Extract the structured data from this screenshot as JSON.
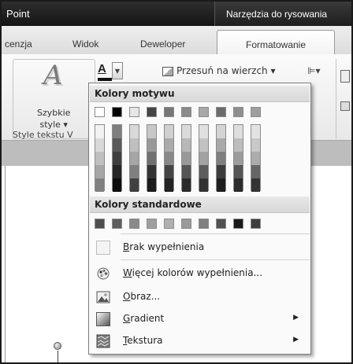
{
  "titlebar": {
    "app_title_fragment": "Point",
    "contextual_title": "Narzędzia do rysowania"
  },
  "tabs": [
    {
      "label": "cenzja",
      "active": false
    },
    {
      "label": "Widok",
      "active": false
    },
    {
      "label": "Deweloper",
      "active": false
    },
    {
      "label": "Formatowanie",
      "active": true
    }
  ],
  "ribbon": {
    "quick_styles_label_line1": "Szybkie",
    "quick_styles_label_line2": "style ▾",
    "group_label": "Style tekstu V",
    "font_color_glyph": "A",
    "bring_forward_label": "Przesuń na wierzch ▾",
    "align_glyph": "⊫▾"
  },
  "popup": {
    "theme_colors_header": "Kolory motywu",
    "standard_colors_header": "Kolory standardowe",
    "theme_top_row": [
      "#ffffff",
      "#000000",
      "#e6e6e6",
      "#444444",
      "#777777",
      "#8a8a8a",
      "#a8a8a8",
      "#6b6b6b",
      "#8f8f8f",
      "#9e9e9e"
    ],
    "theme_columns": [
      [
        "#f2f2f2",
        "#d9d9d9",
        "#bfbfbf",
        "#a6a6a6",
        "#808080"
      ],
      [
        "#7f7f7f",
        "#595959",
        "#3f3f3f",
        "#262626",
        "#0d0d0d"
      ],
      [
        "#d9d9d9",
        "#bfbfbf",
        "#a6a6a6",
        "#808080",
        "#404040"
      ],
      [
        "#c8c8c8",
        "#999999",
        "#707070",
        "#333333",
        "#1a1a1a"
      ],
      [
        "#d0d0d0",
        "#aaaaaa",
        "#888888",
        "#444444",
        "#222222"
      ],
      [
        "#dadada",
        "#b8b8b8",
        "#999999",
        "#555555",
        "#2a2a2a"
      ],
      [
        "#e0e0e0",
        "#c2c2c2",
        "#a3a3a3",
        "#5c5c5c",
        "#333333"
      ],
      [
        "#d4d4d4",
        "#a9a9a9",
        "#7f7f7f",
        "#3c3c3c",
        "#1e1e1e"
      ],
      [
        "#dedede",
        "#bdbdbd",
        "#9c9c9c",
        "#555555",
        "#2b2b2b"
      ],
      [
        "#e3e3e3",
        "#c8c8c8",
        "#acacac",
        "#666666",
        "#333333"
      ]
    ],
    "standard_row": [
      "#4d4d4d",
      "#5e5e5e",
      "#8a8a8a",
      "#a0a0a0",
      "#b0b0b0",
      "#9a9a9a",
      "#808080",
      "#505050",
      "#1a1a1a",
      "#3d3d3d"
    ],
    "no_fill": {
      "ul": "B",
      "rest": "rak wypełnienia"
    },
    "more_colors": {
      "ul": "W",
      "rest": "ięcej kolorów wypełnienia..."
    },
    "picture": {
      "ul": "O",
      "rest": "braz..."
    },
    "gradient": {
      "ul": "G",
      "rest": "radient"
    },
    "texture": {
      "ul": "T",
      "rest": "ekstura"
    }
  }
}
